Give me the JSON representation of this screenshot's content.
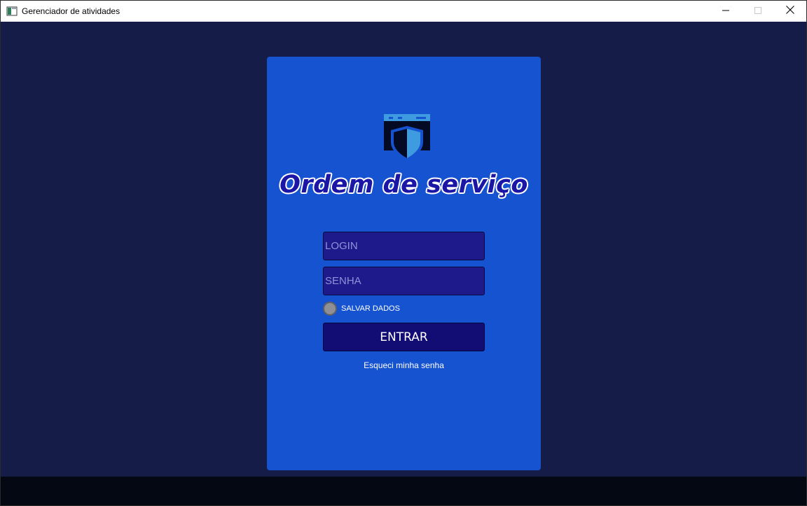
{
  "window": {
    "title": "Gerenciador de atividades",
    "app_icon": "window-app-icon",
    "controls": {
      "minimize_icon": "minimize-icon",
      "maximize_icon": "maximize-icon",
      "close_icon": "close-icon"
    }
  },
  "colors": {
    "background": "#141c47",
    "card": "#1653d1",
    "field": "#1e1a8c",
    "button": "#120c75",
    "bottom_bar": "#040813",
    "headline": "#1c16a6"
  },
  "login_card": {
    "logo_icon": "shield-window-icon",
    "headline": "Ordem de serviço",
    "login_field": {
      "placeholder": "LOGIN",
      "value": ""
    },
    "password_field": {
      "placeholder": "SENHA",
      "value": ""
    },
    "save_data": {
      "label": "SALVAR DADOS",
      "checked": false
    },
    "enter_button": {
      "label": "ENTRAR"
    },
    "forgot_link": {
      "label": "Esqueci minha senha"
    }
  }
}
